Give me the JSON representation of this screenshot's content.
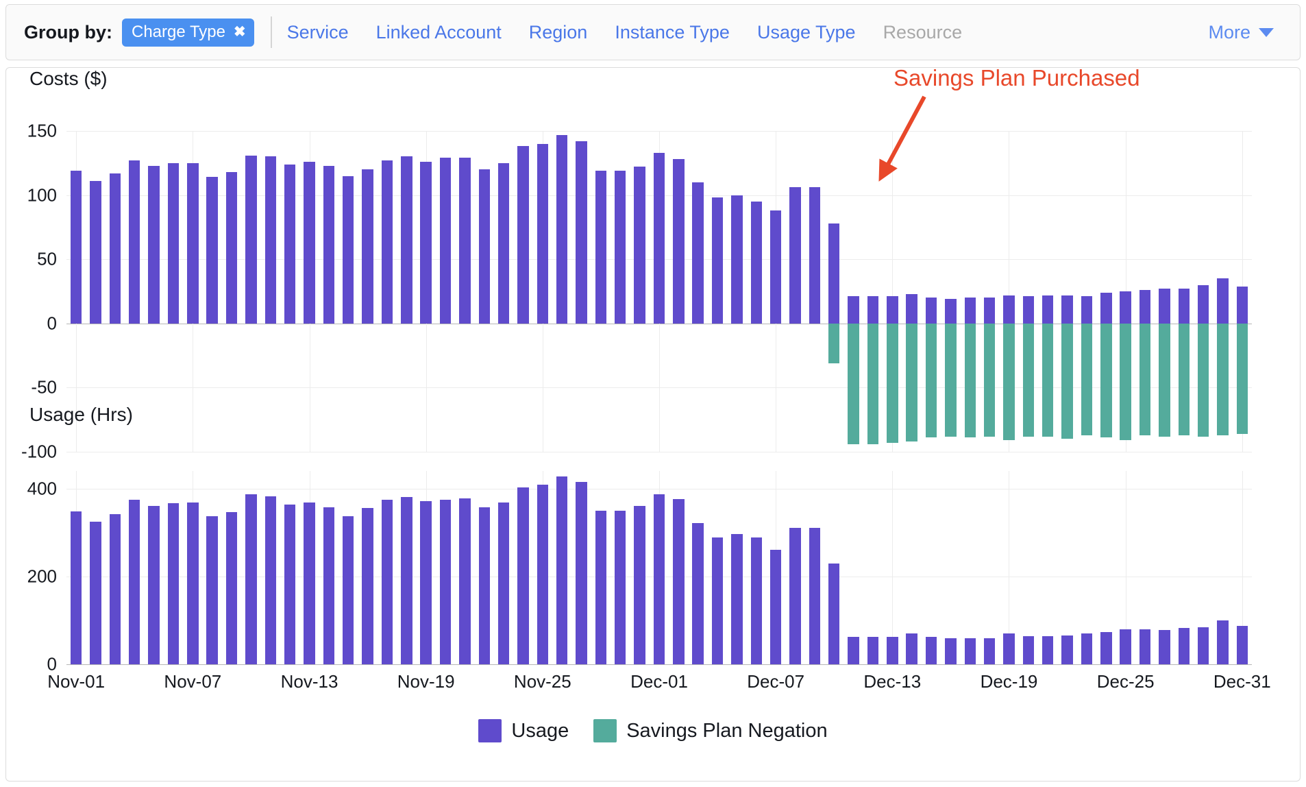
{
  "toolbar": {
    "group_by_label": "Group by:",
    "active_chip": {
      "label": "Charge Type",
      "remove_icon": "✖"
    },
    "links": [
      {
        "label": "Service",
        "disabled": false
      },
      {
        "label": "Linked Account",
        "disabled": false
      },
      {
        "label": "Region",
        "disabled": false
      },
      {
        "label": "Instance Type",
        "disabled": false
      },
      {
        "label": "Usage Type",
        "disabled": false
      },
      {
        "label": "Resource",
        "disabled": true
      }
    ],
    "more_label": "More"
  },
  "annotation": {
    "text": "Savings Plan Purchased",
    "color": "#e8482a"
  },
  "colors": {
    "usage": "#5f4bcc",
    "savings_plan_negation": "#54ab9c",
    "accent_link": "#4a77e8",
    "chip_bg": "#4a90f0",
    "annotation": "#e8482a"
  },
  "legend": {
    "items": [
      {
        "label": "Usage",
        "color": "#5f4bcc"
      },
      {
        "label": "Savings Plan Negation",
        "color": "#54ab9c"
      }
    ]
  },
  "chart_data": [
    {
      "type": "bar",
      "id": "costs",
      "title": "Costs ($)",
      "xlabel": "",
      "ylabel": "Costs ($)",
      "ylim": [
        -100,
        150
      ],
      "yticks": [
        150,
        100,
        50,
        0,
        -50,
        -100
      ],
      "grid": true,
      "stacked": true,
      "categories": [
        "Nov-01",
        "Nov-02",
        "Nov-03",
        "Nov-04",
        "Nov-05",
        "Nov-06",
        "Nov-07",
        "Nov-08",
        "Nov-09",
        "Nov-10",
        "Nov-11",
        "Nov-12",
        "Nov-13",
        "Nov-14",
        "Nov-15",
        "Nov-16",
        "Nov-17",
        "Nov-18",
        "Nov-19",
        "Nov-20",
        "Nov-21",
        "Nov-22",
        "Nov-23",
        "Nov-24",
        "Nov-25",
        "Nov-26",
        "Nov-27",
        "Nov-28",
        "Nov-29",
        "Nov-30",
        "Dec-01",
        "Dec-02",
        "Dec-03",
        "Dec-04",
        "Dec-05",
        "Dec-06",
        "Dec-07",
        "Dec-08",
        "Dec-09",
        "Dec-10",
        "Dec-11",
        "Dec-12",
        "Dec-13",
        "Dec-14",
        "Dec-15",
        "Dec-16",
        "Dec-17",
        "Dec-18",
        "Dec-19",
        "Dec-20",
        "Dec-21",
        "Dec-22",
        "Dec-23",
        "Dec-24",
        "Dec-25",
        "Dec-26",
        "Dec-27",
        "Dec-28",
        "Dec-29",
        "Dec-30",
        "Dec-31"
      ],
      "xticks": [
        "Nov-01",
        "Nov-07",
        "Nov-13",
        "Nov-19",
        "Nov-25",
        "Dec-01",
        "Dec-07",
        "Dec-13",
        "Dec-19",
        "Dec-25",
        "Dec-31"
      ],
      "series": [
        {
          "name": "Usage",
          "color": "#5f4bcc",
          "values": [
            119,
            111,
            117,
            127,
            123,
            125,
            125,
            114,
            118,
            131,
            130,
            124,
            126,
            123,
            115,
            120,
            127,
            130,
            126,
            129,
            129,
            120,
            125,
            138,
            140,
            147,
            142,
            119,
            119,
            122,
            133,
            128,
            110,
            98,
            100,
            95,
            88,
            106,
            106,
            78,
            21,
            21,
            21,
            23,
            20,
            19,
            20,
            20,
            22,
            21,
            22,
            22,
            21,
            24,
            25,
            26,
            27,
            27,
            30,
            35,
            29
          ]
        },
        {
          "name": "Savings Plan Negation",
          "color": "#54ab9c",
          "values": [
            0,
            0,
            0,
            0,
            0,
            0,
            0,
            0,
            0,
            0,
            0,
            0,
            0,
            0,
            0,
            0,
            0,
            0,
            0,
            0,
            0,
            0,
            0,
            0,
            0,
            0,
            0,
            0,
            0,
            0,
            0,
            0,
            0,
            0,
            0,
            0,
            0,
            0,
            0,
            -31,
            -94,
            -94,
            -93,
            -92,
            -89,
            -88,
            -89,
            -88,
            -91,
            -88,
            -88,
            -90,
            -87,
            -89,
            -91,
            -87,
            -88,
            -87,
            -88,
            -87,
            -86
          ]
        }
      ]
    },
    {
      "type": "bar",
      "id": "usage",
      "title": "Usage (Hrs)",
      "xlabel": "",
      "ylabel": "Usage (Hrs)",
      "ylim": [
        0,
        440
      ],
      "yticks": [
        400,
        200,
        0
      ],
      "grid": true,
      "stacked": false,
      "categories": [
        "Nov-01",
        "Nov-02",
        "Nov-03",
        "Nov-04",
        "Nov-05",
        "Nov-06",
        "Nov-07",
        "Nov-08",
        "Nov-09",
        "Nov-10",
        "Nov-11",
        "Nov-12",
        "Nov-13",
        "Nov-14",
        "Nov-15",
        "Nov-16",
        "Nov-17",
        "Nov-18",
        "Nov-19",
        "Nov-20",
        "Nov-21",
        "Nov-22",
        "Nov-23",
        "Nov-24",
        "Nov-25",
        "Nov-26",
        "Nov-27",
        "Nov-28",
        "Nov-29",
        "Nov-30",
        "Dec-01",
        "Dec-02",
        "Dec-03",
        "Dec-04",
        "Dec-05",
        "Dec-06",
        "Dec-07",
        "Dec-08",
        "Dec-09",
        "Dec-10",
        "Dec-11",
        "Dec-12",
        "Dec-13",
        "Dec-14",
        "Dec-15",
        "Dec-16",
        "Dec-17",
        "Dec-18",
        "Dec-19",
        "Dec-20",
        "Dec-21",
        "Dec-22",
        "Dec-23",
        "Dec-24",
        "Dec-25",
        "Dec-26",
        "Dec-27",
        "Dec-28",
        "Dec-29",
        "Dec-30",
        "Dec-31"
      ],
      "xticks": [
        "Nov-01",
        "Nov-07",
        "Nov-13",
        "Nov-19",
        "Nov-25",
        "Dec-01",
        "Dec-07",
        "Dec-13",
        "Dec-19",
        "Dec-25",
        "Dec-31"
      ],
      "series": [
        {
          "name": "Usage",
          "color": "#5f4bcc",
          "values": [
            348,
            325,
            342,
            374,
            361,
            367,
            368,
            337,
            346,
            387,
            383,
            363,
            368,
            358,
            337,
            355,
            374,
            381,
            372,
            375,
            377,
            357,
            369,
            403,
            409,
            427,
            415,
            350,
            350,
            361,
            387,
            376,
            322,
            288,
            296,
            288,
            261,
            311,
            311,
            230,
            63,
            62,
            62,
            70,
            62,
            60,
            60,
            60,
            70,
            64,
            64,
            66,
            70,
            74,
            80,
            80,
            78,
            82,
            84,
            100,
            88
          ]
        }
      ]
    }
  ]
}
